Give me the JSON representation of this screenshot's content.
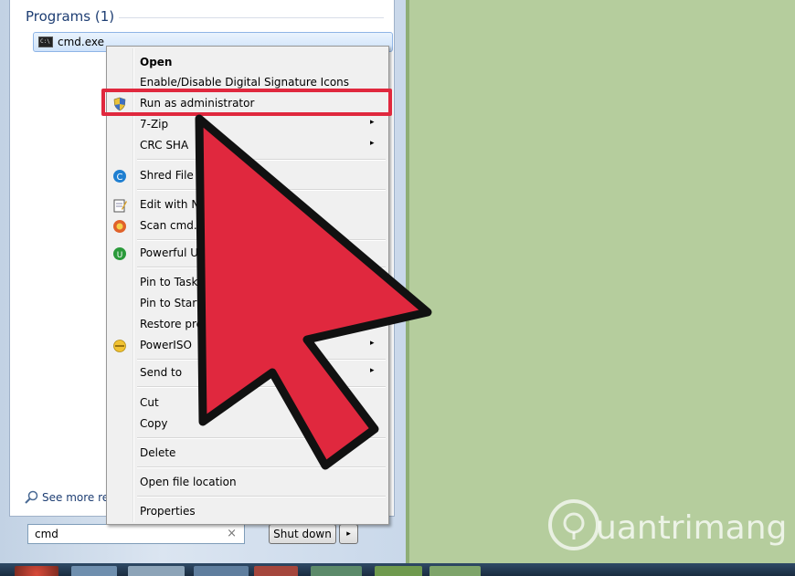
{
  "start_menu": {
    "programs_header": "Programs (1)",
    "program_item": "cmd.exe",
    "see_more": "See more re",
    "search_value": "cmd",
    "search_clear": "×",
    "shutdown_label": "Shut down",
    "shutdown_arrow": "▸"
  },
  "context_menu": {
    "items": [
      {
        "label": "Open",
        "icon": "",
        "submenu": false
      },
      {
        "label": "Enable/Disable Digital Signature Icons",
        "icon": "",
        "submenu": false
      },
      {
        "label": "Run as administrator",
        "icon": "uac-shield-icon",
        "submenu": false
      },
      {
        "label": "7-Zip",
        "icon": "",
        "submenu": true
      },
      {
        "label": "CRC SHA",
        "icon": "",
        "submenu": true
      },
      {
        "label": "Shred File",
        "icon": "shred-icon",
        "submenu": false
      },
      {
        "label": "Edit with N",
        "icon": "notepad-icon",
        "submenu": false
      },
      {
        "label": "Scan cmd.e",
        "icon": "antivirus-icon",
        "submenu": false
      },
      {
        "label": "Powerful U",
        "icon": "uninstaller-icon",
        "submenu": false
      },
      {
        "label": "Pin to Task",
        "icon": "",
        "submenu": false
      },
      {
        "label": "Pin to Start",
        "icon": "",
        "submenu": false
      },
      {
        "label": "Restore pre",
        "icon": "",
        "submenu": false
      },
      {
        "label": "PowerISO",
        "icon": "poweriso-icon",
        "submenu": true
      },
      {
        "label": "Send to",
        "icon": "",
        "submenu": true
      },
      {
        "label": "Cut",
        "icon": "",
        "submenu": false
      },
      {
        "label": "Copy",
        "icon": "",
        "submenu": false
      },
      {
        "label": "Delete",
        "icon": "",
        "submenu": false
      },
      {
        "label": "Open file location",
        "icon": "",
        "submenu": false
      },
      {
        "label": "Properties",
        "icon": "",
        "submenu": false
      }
    ],
    "submenu_glyph": "▸"
  },
  "watermark": {
    "text": "uantrimang"
  },
  "colors": {
    "desktop": "#b5cd9d",
    "highlight_border": "#e0283e",
    "arrow_fill": "#e0283e",
    "programs_header": "#1e3e73"
  }
}
